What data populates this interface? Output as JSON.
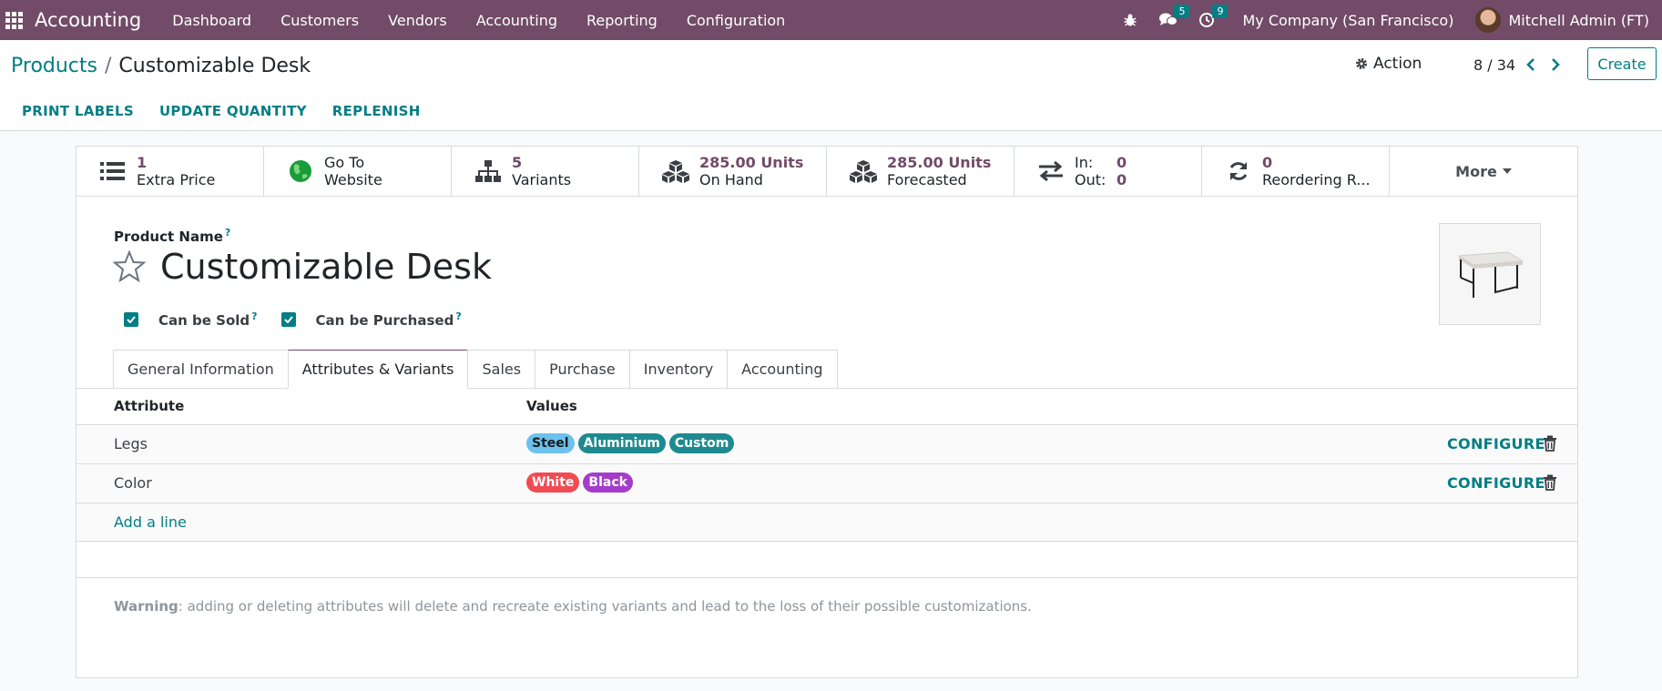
{
  "navbar": {
    "brand": "Accounting",
    "menu": [
      "Dashboard",
      "Customers",
      "Vendors",
      "Accounting",
      "Reporting",
      "Configuration"
    ],
    "messages_count": "5",
    "activities_count": "9",
    "company": "My Company (San Francisco)",
    "user": "Mitchell Admin (FT)"
  },
  "breadcrumb": {
    "parent": "Products",
    "separator": "/",
    "current": "Customizable Desk"
  },
  "control": {
    "action_label": "Action",
    "pager": "8 / 34",
    "create_label": "Create"
  },
  "toolbar": {
    "print_labels": "PRINT LABELS",
    "update_quantity": "UPDATE QUANTITY",
    "replenish": "REPLENISH"
  },
  "stats": {
    "extra_price": {
      "value": "1",
      "label": "Extra Price"
    },
    "website": {
      "value": "Go To",
      "label": "Website"
    },
    "variants": {
      "value": "5",
      "label": "Variants"
    },
    "on_hand": {
      "value": "285.00 Units",
      "label": "On Hand"
    },
    "forecasted": {
      "value": "285.00 Units",
      "label": "Forecasted"
    },
    "inout": {
      "in_label": "In:",
      "in_value": "0",
      "out_label": "Out:",
      "out_value": "0"
    },
    "reordering": {
      "value": "0",
      "label": "Reordering R..."
    },
    "more": "More"
  },
  "product": {
    "name_label": "Product Name",
    "tooltip": "?",
    "name": "Customizable Desk",
    "can_be_sold": "Can be Sold",
    "can_be_purchased": "Can be Purchased"
  },
  "tabs": [
    "General Information",
    "Attributes & Variants",
    "Sales",
    "Purchase",
    "Inventory",
    "Accounting"
  ],
  "active_tab": "Attributes & Variants",
  "attributes": {
    "col_attribute": "Attribute",
    "col_values": "Values",
    "rows": [
      {
        "name": "Legs",
        "values": [
          {
            "label": "Steel",
            "bg": "#6cc1ed",
            "fg": "#1a1a1a"
          },
          {
            "label": "Aluminium",
            "bg": "#1e8a8f",
            "fg": "#ffffff"
          },
          {
            "label": "Custom",
            "bg": "#1e8a8f",
            "fg": "#ffffff"
          }
        ],
        "configure": "CONFIGURE"
      },
      {
        "name": "Color",
        "values": [
          {
            "label": "White",
            "bg": "#f04b52",
            "fg": "#ffffff"
          },
          {
            "label": "Black",
            "bg": "#a43cc9",
            "fg": "#ffffff"
          }
        ],
        "configure": "CONFIGURE"
      }
    ],
    "add_line": "Add a line"
  },
  "warning": {
    "title": "Warning",
    "text": ": adding or deleting attributes will delete and recreate existing variants and lead to the loss of their possible customizations."
  },
  "colors": {
    "brand": "#714b67",
    "accent": "#017e84"
  }
}
